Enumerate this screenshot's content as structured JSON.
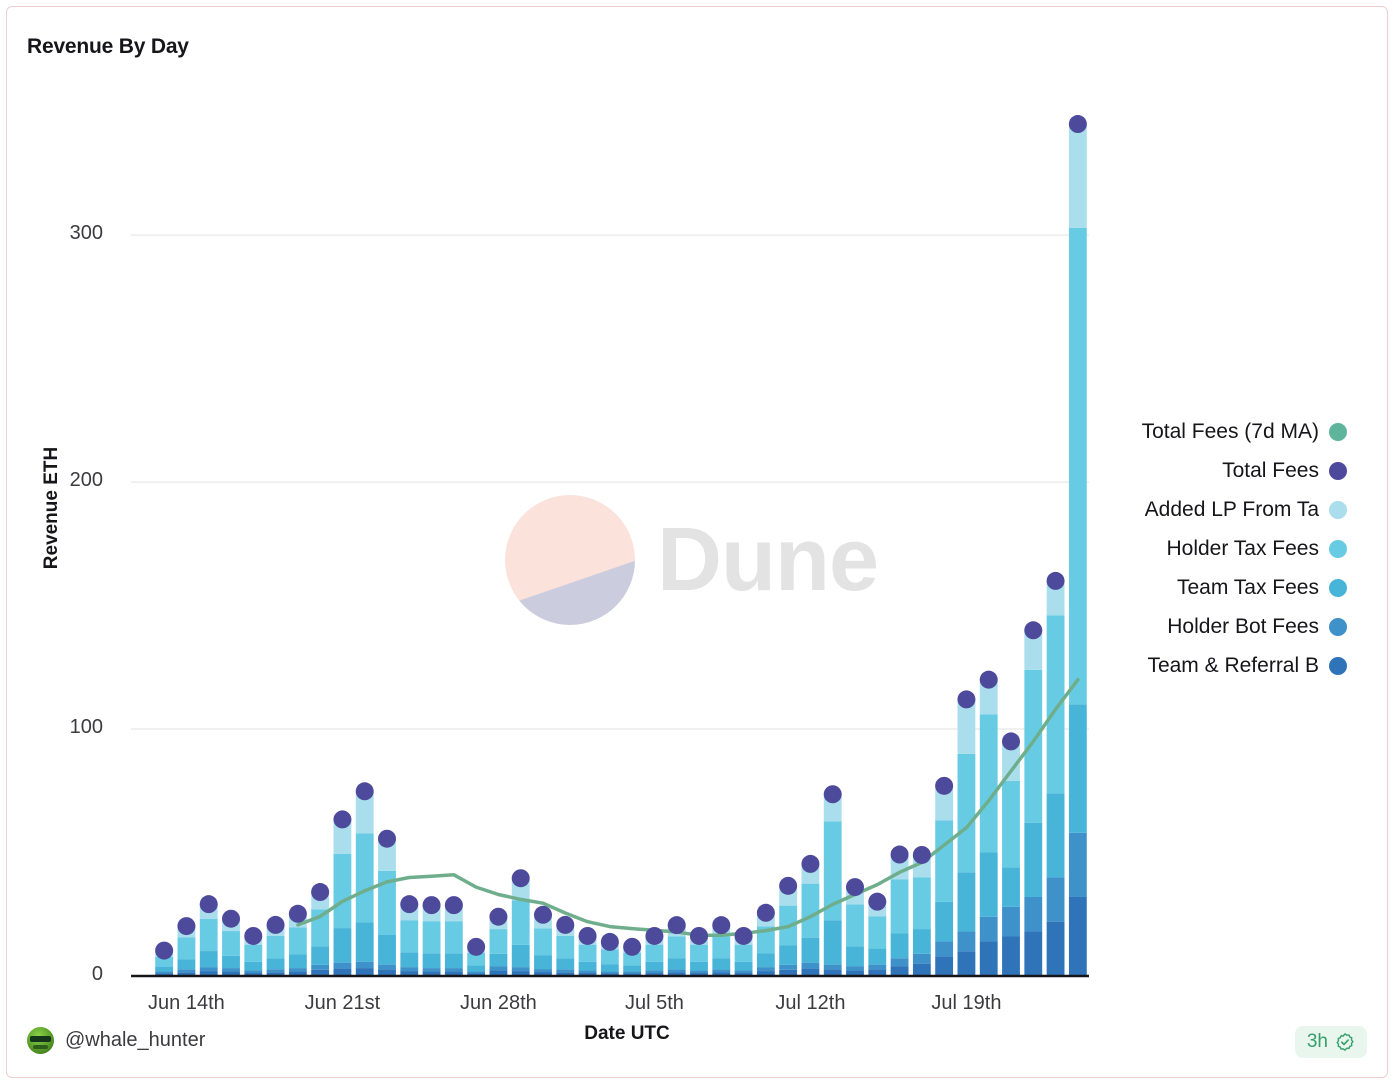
{
  "card": {
    "title": "Revenue By Day",
    "border_color": "#f0cfcd",
    "background": "#ffffff"
  },
  "watermark": {
    "text": "Dune",
    "mark_top_color": "#fbe3dc",
    "mark_bottom_color": "#ccccdf",
    "text_color": "#e3e3e3"
  },
  "footer": {
    "username": "@whale_hunter",
    "refresh_badge": "3h",
    "badge_color": "#36a06a",
    "badge_bg": "#e9f6ee"
  },
  "legend": {
    "position": "right",
    "items": [
      {
        "label": "Total Fees (7d MA)",
        "color": "#5fb49c"
      },
      {
        "label": "Total Fees",
        "color": "#4e4a9b"
      },
      {
        "label": "Added LP From Ta",
        "color": "#aadeec"
      },
      {
        "label": "Holder Tax Fees",
        "color": "#67cbe4"
      },
      {
        "label": "Team Tax Fees",
        "color": "#47b4d8"
      },
      {
        "label": "Holder Bot Fees",
        "color": "#3e91c9"
      },
      {
        "label": "Team & Referral B",
        "color": "#2f73b8"
      }
    ]
  },
  "chart_data": {
    "type": "bar",
    "title": "Revenue By Day",
    "xlabel": "Date UTC",
    "ylabel": "Revenue ETH",
    "ylim": [
      0,
      360
    ],
    "yticks": [
      0,
      100,
      200,
      300
    ],
    "ytick_labels": [
      "0",
      "100",
      "200",
      "300"
    ],
    "grid": true,
    "stacked": true,
    "x": [
      "Jun 13th",
      "Jun 14th",
      "Jun 15th",
      "Jun 16th",
      "Jun 17th",
      "Jun 18th",
      "Jun 19th",
      "Jun 20th",
      "Jun 21st",
      "Jun 22nd",
      "Jun 23rd",
      "Jun 24th",
      "Jun 25th",
      "Jun 26th",
      "Jun 27th",
      "Jun 28th",
      "Jun 29th",
      "Jun 30th",
      "Jul 1st",
      "Jul 2nd",
      "Jul 3rd",
      "Jul 4th",
      "Jul 5th",
      "Jul 6th",
      "Jul 7th",
      "Jul 8th",
      "Jul 9th",
      "Jul 10th",
      "Jul 11th",
      "Jul 12th",
      "Jul 13th",
      "Jul 14th",
      "Jul 15th",
      "Jul 16th",
      "Jul 17th",
      "Jul 18th",
      "Jul 19th",
      "Jul 20th",
      "Jul 21st",
      "Jul 22nd",
      "Jul 23rd",
      "Jul 24th"
    ],
    "xtick_labels": [
      "Jun 14th",
      "Jun 21st",
      "Jun 28th",
      "Jul 5th",
      "Jul 12th",
      "Jul 19th"
    ],
    "xtick_indices": [
      1,
      8,
      15,
      22,
      29,
      36
    ],
    "series": [
      {
        "name": "Team & Referral B",
        "color": "#2f73b8",
        "values": [
          1.0,
          1.5,
          2.0,
          1.8,
          1.2,
          1.5,
          1.8,
          2.5,
          3.0,
          3.2,
          2.6,
          2.0,
          1.8,
          1.8,
          1.0,
          2.2,
          2.0,
          1.6,
          1.5,
          1.2,
          1.0,
          1.0,
          1.2,
          1.4,
          1.2,
          1.4,
          1.2,
          2.0,
          2.5,
          3.0,
          2.6,
          2.2,
          2.6,
          4.0,
          5.0,
          8.0,
          10.0,
          14.0,
          16.0,
          18.0,
          22.0,
          32.0
        ]
      },
      {
        "name": "Holder Bot Fees",
        "color": "#3e91c9",
        "values": [
          0.8,
          1.2,
          1.6,
          1.4,
          1.0,
          1.2,
          1.4,
          2.0,
          2.4,
          2.6,
          2.0,
          1.6,
          1.4,
          1.4,
          0.8,
          1.8,
          1.6,
          1.2,
          1.2,
          1.0,
          0.8,
          0.8,
          1.0,
          1.2,
          1.0,
          1.2,
          1.0,
          1.6,
          2.0,
          2.4,
          2.0,
          1.8,
          2.0,
          3.2,
          4.0,
          6.0,
          8.0,
          10.0,
          12.0,
          14.0,
          18.0,
          26.0
        ]
      },
      {
        "name": "Team Tax Fees",
        "color": "#47b4d8",
        "values": [
          2.0,
          4.0,
          6.5,
          5.0,
          3.5,
          4.5,
          5.5,
          7.5,
          14.0,
          16.0,
          12.0,
          6.0,
          6.0,
          6.0,
          2.5,
          5.0,
          9.0,
          5.5,
          4.5,
          3.5,
          3.0,
          2.5,
          3.5,
          4.5,
          3.5,
          4.5,
          3.5,
          5.5,
          8.0,
          10.0,
          18.0,
          8.0,
          6.5,
          10.0,
          10.0,
          16.0,
          24.0,
          26.0,
          16.0,
          30.0,
          34.0,
          52.0
        ]
      },
      {
        "name": "Holder Tax Fees",
        "color": "#67cbe4",
        "values": [
          4.0,
          9.0,
          13.0,
          10.0,
          7.0,
          9.0,
          11.0,
          15.0,
          30.0,
          36.0,
          26.0,
          13.0,
          13.0,
          13.0,
          5.0,
          10.0,
          18.0,
          11.0,
          9.0,
          7.0,
          6.0,
          5.0,
          7.0,
          9.0,
          7.0,
          9.0,
          7.0,
          11.0,
          16.0,
          22.0,
          40.0,
          17.0,
          13.0,
          22.0,
          21.0,
          33.0,
          48.0,
          56.0,
          35.0,
          62.0,
          72.0,
          193.0
        ]
      },
      {
        "name": "Added LP From Ta",
        "color": "#aadeec",
        "values": [
          2.5,
          4.5,
          6.0,
          5.0,
          3.5,
          4.5,
          5.5,
          7.0,
          14.0,
          17.0,
          13.0,
          6.5,
          6.5,
          6.5,
          2.5,
          5.0,
          9.0,
          5.5,
          4.5,
          3.5,
          3.0,
          2.5,
          3.5,
          4.5,
          3.5,
          4.5,
          3.5,
          5.5,
          8.0,
          8.0,
          11.0,
          7.0,
          6.0,
          10.0,
          9.0,
          14.0,
          22.0,
          14.0,
          16.0,
          16.0,
          14.0,
          42.0
        ]
      }
    ],
    "markers": {
      "name": "Total Fees",
      "color": "#4e4a9b",
      "values": [
        10.3,
        20.2,
        29.1,
        23.2,
        16.2,
        20.7,
        25.2,
        34.0,
        63.4,
        74.8,
        55.6,
        29.1,
        28.7,
        28.7,
        11.8,
        24.0,
        39.6,
        24.8,
        20.7,
        16.2,
        13.8,
        11.8,
        16.2,
        20.6,
        16.2,
        20.6,
        16.2,
        25.6,
        36.5,
        45.4,
        73.6,
        36.0,
        30.1,
        49.2,
        49.0,
        77.0,
        112.0,
        120.0,
        95.0,
        140.0,
        160.0,
        345.0
      ]
    },
    "ma_line": {
      "name": "Total Fees (7d MA)",
      "color": "#6fae8d",
      "values": [
        null,
        null,
        null,
        null,
        null,
        null,
        20.7,
        24.1,
        30.2,
        34.5,
        38.1,
        39.9,
        40.4,
        41.0,
        36.0,
        33.0,
        31.0,
        29.5,
        25.5,
        22.0,
        20.0,
        19.2,
        18.5,
        17.8,
        16.5,
        16.5,
        17.3,
        18.4,
        20.0,
        24.0,
        29.0,
        33.0,
        37.0,
        42.0,
        46.0,
        53.0,
        60.0,
        71.0,
        83.0,
        95.0,
        108.0,
        120.0
      ]
    }
  }
}
